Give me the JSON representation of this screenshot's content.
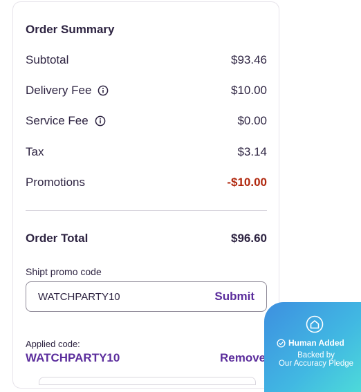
{
  "summary": {
    "heading": "Order Summary",
    "subtotal_label": "Subtotal",
    "subtotal_value": "$93.46",
    "delivery_label": "Delivery Fee",
    "delivery_value": "$10.00",
    "service_label": "Service Fee",
    "service_value": "$0.00",
    "tax_label": "Tax",
    "tax_value": "$3.14",
    "promotions_label": "Promotions",
    "promotions_value": "-$10.00",
    "total_label": "Order Total",
    "total_value": "$96.60"
  },
  "promo": {
    "label": "Shipt promo code",
    "value": "WATCHPARTY10",
    "submit_label": "Submit",
    "applied_label": "Applied code:",
    "applied_code": "WATCHPARTY10",
    "remove_label": "Remove"
  },
  "badge": {
    "title": "Human Added",
    "subtitle_line1": "Backed by",
    "subtitle_line2": "Our Accuracy Pledge"
  },
  "colors": {
    "accent_purple": "#5b2d9c",
    "promo_red": "#b0270d",
    "text_dark": "#2d2341"
  },
  "icons": {
    "delivery_info": "info-icon",
    "service_info": "info-icon",
    "badge_main": "house-shield-icon",
    "badge_check": "check-circle-icon"
  }
}
